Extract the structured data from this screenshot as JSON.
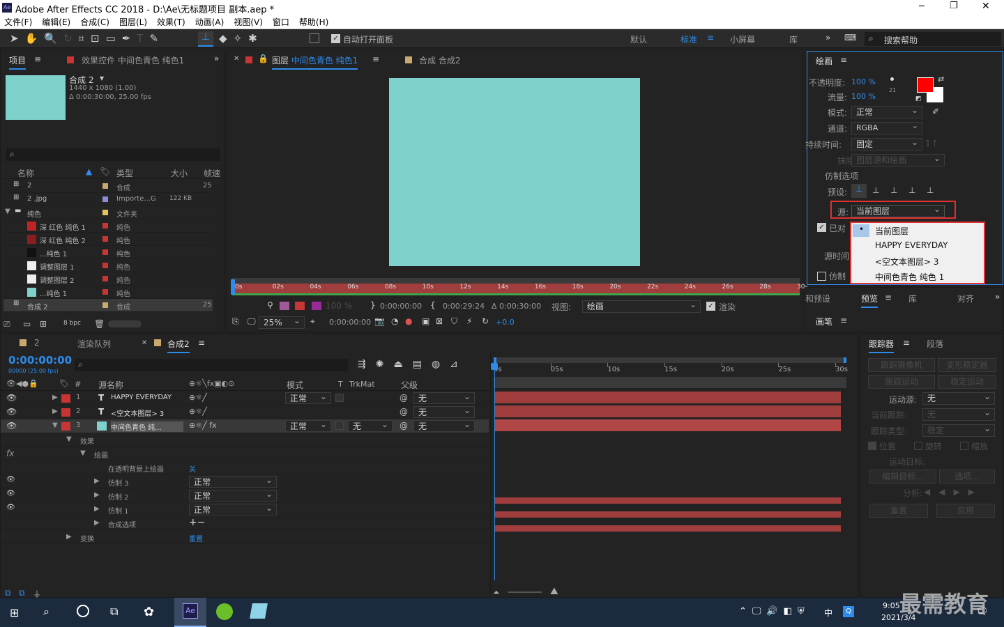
{
  "window": {
    "title": "Adobe After Effects CC 2018 - D:\\Ae\\无标题项目 副本.aep *",
    "minimize": "─",
    "maximize": "❐",
    "close": "✕"
  },
  "menu": [
    "文件(F)",
    "编辑(E)",
    "合成(C)",
    "图层(L)",
    "效果(T)",
    "动画(A)",
    "视图(V)",
    "窗口",
    "帮助(H)"
  ],
  "toolbar": {
    "auto_open": "自动打开面板",
    "workspaces": [
      "默认",
      "标准",
      "小屏幕",
      "库"
    ],
    "search_placeholder": "搜索帮助"
  },
  "project": {
    "tab_project": "项目",
    "tab_effects": "效果控件 中间色青色 纯色1",
    "comp_name": "合成 2",
    "comp_info1": "1440 x 1080 (1.00)",
    "comp_info2": "Δ 0:00:30:00, 25.00 fps",
    "col_name": "名称",
    "col_type": "类型",
    "col_size": "大小",
    "col_fps": "帧速",
    "items": [
      {
        "name": "2",
        "type": "合成",
        "size": "",
        "fps": "25",
        "color": "#c9a96e"
      },
      {
        "name": "2 .jpg",
        "type": "Importe...G",
        "size": "122 KB",
        "fps": "",
        "color": "#8d8dd4"
      },
      {
        "name": "纯色",
        "type": "文件夹",
        "size": "",
        "fps": "",
        "color": "#e2c35a"
      },
      {
        "name": "深 红色 纯色 1",
        "type": "纯色",
        "size": "",
        "fps": "",
        "color": "#c93434"
      },
      {
        "name": "深 红色 纯色 2",
        "type": "纯色",
        "size": "",
        "fps": "",
        "color": "#c93434"
      },
      {
        "name": "...纯色 1",
        "type": "纯色",
        "size": "",
        "fps": "",
        "color": "#c93434"
      },
      {
        "name": "调整图层 1",
        "type": "纯色",
        "size": "",
        "fps": "",
        "color": "#c93434"
      },
      {
        "name": "调整图层 2",
        "type": "纯色",
        "size": "",
        "fps": "",
        "color": "#c93434"
      },
      {
        "name": "...纯色 1",
        "type": "纯色",
        "size": "",
        "fps": "",
        "color": "#c93434"
      },
      {
        "name": "合成 2",
        "type": "合成",
        "size": "",
        "fps": "25",
        "color": "#c9a96e"
      }
    ],
    "bpc": "8 bpc"
  },
  "viewer": {
    "tab_layer": "图层",
    "tab_layer_name": "中间色青色 纯色1",
    "tab_comp": "合成 合成2",
    "ruler": [
      "0s",
      "02s",
      "04s",
      "06s",
      "08s",
      "10s",
      "12s",
      "14s",
      "16s",
      "18s",
      "20s",
      "22s",
      "24s",
      "26s",
      "28s",
      "30s"
    ],
    "in": "0:00:00:00",
    "out": "0:00:29:24",
    "dur": "Δ 0:00:30:00",
    "view_label": "视图:",
    "view_value": "绘画",
    "render": "渲染",
    "zoom": "25%",
    "time": "0:00:00:00",
    "exposure": "+0.0",
    "opacity_pct": "100 %"
  },
  "paint": {
    "title": "绘画",
    "opacity_label": "不透明度:",
    "opacity": "100 %",
    "flow_label": "流量:",
    "flow": "100 %",
    "mode_label": "模式:",
    "mode": "正常",
    "channel_label": "通道:",
    "channel": "RGBA",
    "duration_label": "持续时间:",
    "duration": "固定",
    "erase_label": "抹除:",
    "erase": "图层源和绘画",
    "clone_opts": "仿制选项",
    "preset_label": "预设:",
    "source_label": "源:",
    "source": "当前图层",
    "aligned": "已对",
    "source_time": "源时间",
    "clone": "仿制",
    "brush_size": "21",
    "dropdown": [
      "当前图层",
      "HAPPY EVERYDAY",
      "<空文本图层> 3",
      "中间色青色 纯色 1"
    ]
  },
  "right_tabs": {
    "presets": "和预设",
    "preview": "预览",
    "library": "库",
    "align": "对齐",
    "brush": "画笔"
  },
  "tracker": {
    "tab": "跟踪器",
    "tab2": "段落",
    "track_camera": "跟踪摄像机",
    "warp": "变形稳定器",
    "track_motion": "跟踪运动",
    "stabilize": "稳定运动",
    "motion_src_label": "运动源:",
    "motion_src": "无",
    "current_track": "当前跟踪:",
    "track_type": "跟踪类型:",
    "track_type_val": "稳定",
    "pos": "位置",
    "rot": "旋转",
    "scale": "缩放",
    "target": "运动目标:",
    "edit_target": "编辑目标...",
    "options": "选项...",
    "analyze": "分析:",
    "reset": "重置",
    "apply": "应用"
  },
  "timeline": {
    "tab1": "2",
    "tab2": "渲染队列",
    "tab3": "合成2",
    "timecode": "0:00:00:00",
    "fps": "00000 (25.00 fps)",
    "col_src": "源名称",
    "col_mode": "模式",
    "col_t": "T",
    "col_trk": "TrkMat",
    "col_parent": "父级",
    "ruler": [
      "0s",
      "05s",
      "10s",
      "15s",
      "20s",
      "25s",
      "30s"
    ],
    "layers": [
      {
        "num": "1",
        "type": "T",
        "name": "HAPPY EVERYDAY",
        "mode": "正常",
        "trk": "",
        "parent": "无"
      },
      {
        "num": "2",
        "type": "T",
        "name": "<空文本图层> 3",
        "mode": "",
        "trk": "",
        "parent": "无"
      },
      {
        "num": "3",
        "type": "",
        "name": "中间色青色 纯...",
        "mode": "正常",
        "trk": "无",
        "parent": "无"
      }
    ],
    "props": {
      "effects": "效果",
      "paint": "绘画",
      "on_transparent": "在透明背景上绘画",
      "on_transparent_val": "关",
      "clone3": "仿制 3",
      "clone2": "仿制 2",
      "clone1": "仿制 1",
      "clone_mode": "正常",
      "composite": "合成选项",
      "transform": "变换",
      "reset": "重置"
    }
  },
  "taskbar": {
    "time": "9:05",
    "date": "2021/3/4",
    "ime": "中",
    "watermark": "最需教育"
  },
  "colors": {
    "accent": "#2d8ceb",
    "teal": "#7fd1cb",
    "red_hl": "#e03030",
    "layer_bar": "#a03d3d"
  }
}
